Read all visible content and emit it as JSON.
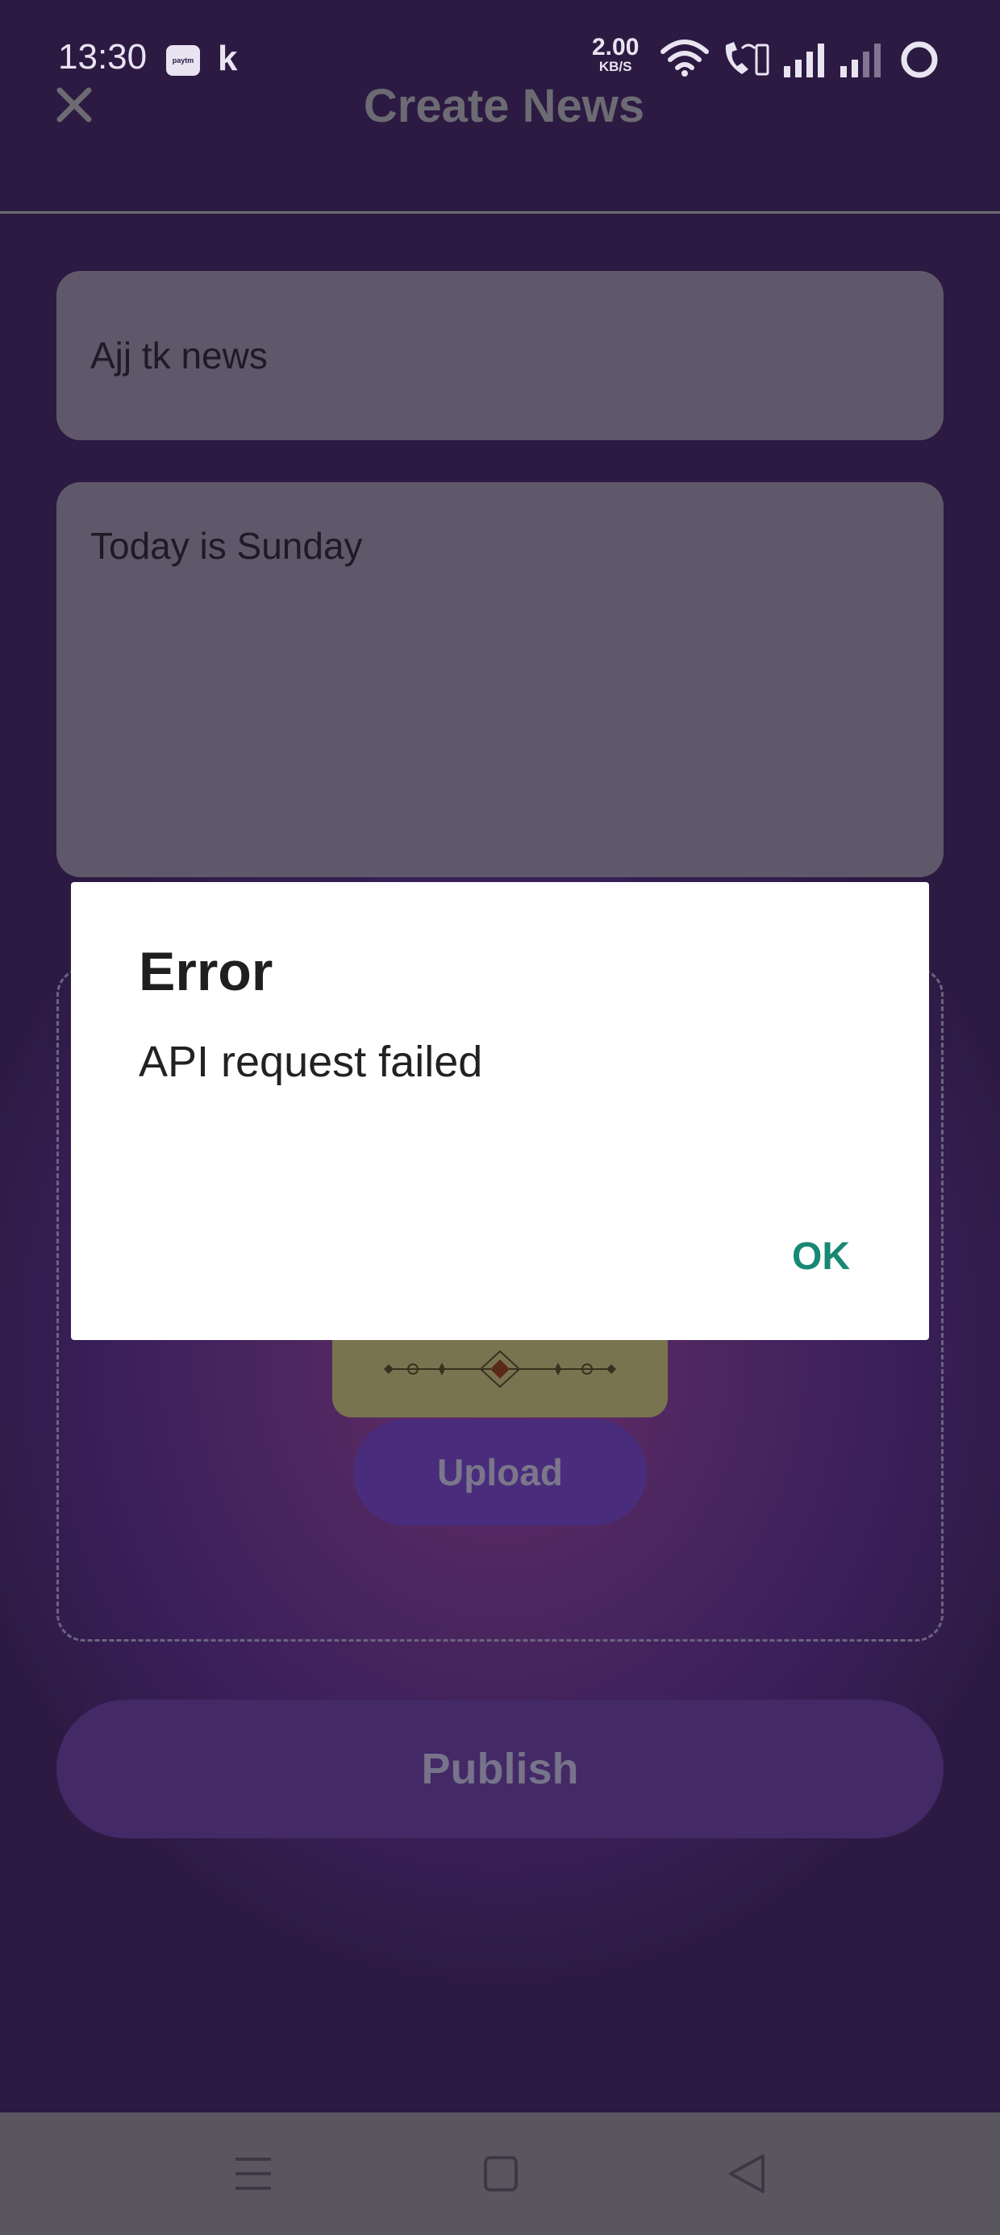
{
  "status_bar": {
    "time": "13:30",
    "apps": [
      "paytm-icon",
      "k-app-icon"
    ],
    "paytm_label": "paytm",
    "k_label": "k",
    "network_speed": "2.00",
    "network_unit": "KB/S",
    "icons": [
      "wifi-icon",
      "wifi-call-icon",
      "signal-1-icon",
      "signal-2-icon",
      "battery-ring-icon"
    ]
  },
  "header": {
    "title": "Create News",
    "close_icon": "close-icon"
  },
  "form": {
    "title_value": "Ajj tk news",
    "body_value": "Today is Sunday",
    "upload_label": "Upload",
    "publish_label": "Publish"
  },
  "dialog": {
    "title": "Error",
    "message": "API request failed",
    "ok_label": "OK"
  },
  "nav_bar": {
    "icons": [
      "menu-icon",
      "home-square-icon",
      "back-triangle-icon"
    ]
  },
  "colors": {
    "background": "#2a1a40",
    "accent_ok": "#178873",
    "button": "#432966"
  }
}
